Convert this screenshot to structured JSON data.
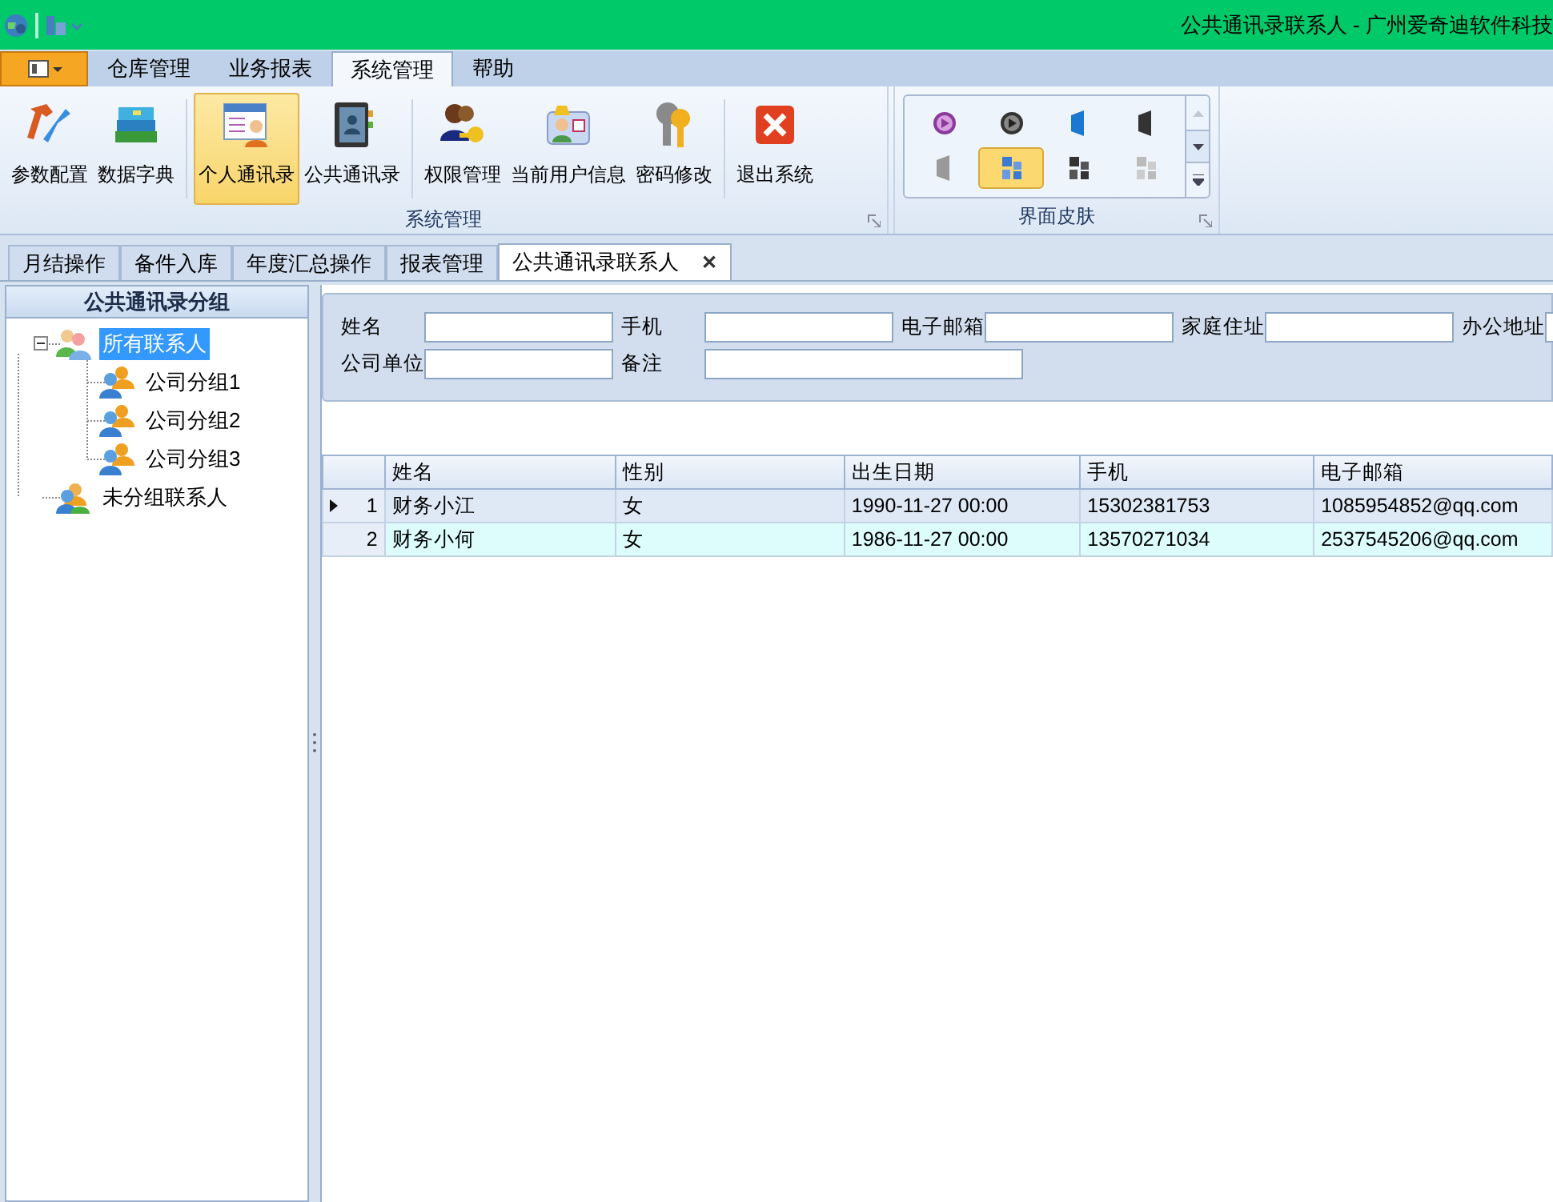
{
  "title_bar": {
    "title": "公共通讯录联系人 - 广州爱奇迪软件科技"
  },
  "ribbon_tabs": [
    {
      "label": "仓库管理",
      "selected": false
    },
    {
      "label": "业务报表",
      "selected": false
    },
    {
      "label": "系统管理",
      "selected": true
    },
    {
      "label": "帮助",
      "selected": false
    }
  ],
  "ribbon_groups": [
    {
      "label": "系统管理",
      "buttons": [
        {
          "label": "参数配置",
          "selected": false
        },
        {
          "label": "数据字典",
          "selected": false
        },
        {
          "label": "个人通讯录",
          "selected": true
        },
        {
          "label": "公共通讯录",
          "selected": false
        },
        {
          "label": "权限管理",
          "selected": false
        },
        {
          "label": "当前用户信息",
          "selected": false
        },
        {
          "label": "密码修改",
          "selected": false
        },
        {
          "label": "退出系统",
          "selected": false
        }
      ]
    }
  ],
  "skin_group": {
    "label": "界面皮肤",
    "skins": [
      {
        "selected": false
      },
      {
        "selected": false
      },
      {
        "selected": false
      },
      {
        "selected": false
      },
      {
        "selected": false
      },
      {
        "selected": true
      },
      {
        "selected": false
      },
      {
        "selected": false
      }
    ]
  },
  "doc_tabs": [
    {
      "label": "月结操作",
      "selected": false
    },
    {
      "label": "备件入库",
      "selected": false
    },
    {
      "label": "年度汇总操作",
      "selected": false
    },
    {
      "label": "报表管理",
      "selected": false
    },
    {
      "label": "公共通讯录联系人",
      "selected": true,
      "close": "✕"
    }
  ],
  "tree": {
    "title": "公共通讯录分组",
    "items": [
      {
        "label": "所有联系人",
        "selected": true,
        "expanded": true,
        "children": [
          {
            "label": "公司分组1",
            "selected": false
          },
          {
            "label": "公司分组2",
            "selected": false
          },
          {
            "label": "公司分组3",
            "selected": false
          }
        ]
      },
      {
        "label": "未分组联系人",
        "selected": false
      }
    ]
  },
  "search_form": {
    "rows": [
      [
        {
          "label": "姓名"
        },
        {
          "label": "手机"
        },
        {
          "label": "电子邮箱"
        },
        {
          "label": "家庭住址"
        },
        {
          "label": "办公地址"
        }
      ],
      [
        {
          "label": "公司单位"
        },
        {
          "label": "备注",
          "wide": true
        }
      ]
    ]
  },
  "grid": {
    "columns": [
      "姓名",
      "性别",
      "出生日期",
      "手机",
      "电子邮箱"
    ],
    "rows": [
      {
        "number": "1",
        "selected": true,
        "cells": [
          "财务小江",
          "女",
          "1990-11-27 00:00",
          "15302381753",
          "1085954852@qq.com"
        ]
      },
      {
        "number": "2",
        "selected": false,
        "cells": [
          "财务小何",
          "女",
          "1986-11-27 00:00",
          "13570271034",
          "2537545206@qq.com"
        ]
      }
    ]
  }
}
